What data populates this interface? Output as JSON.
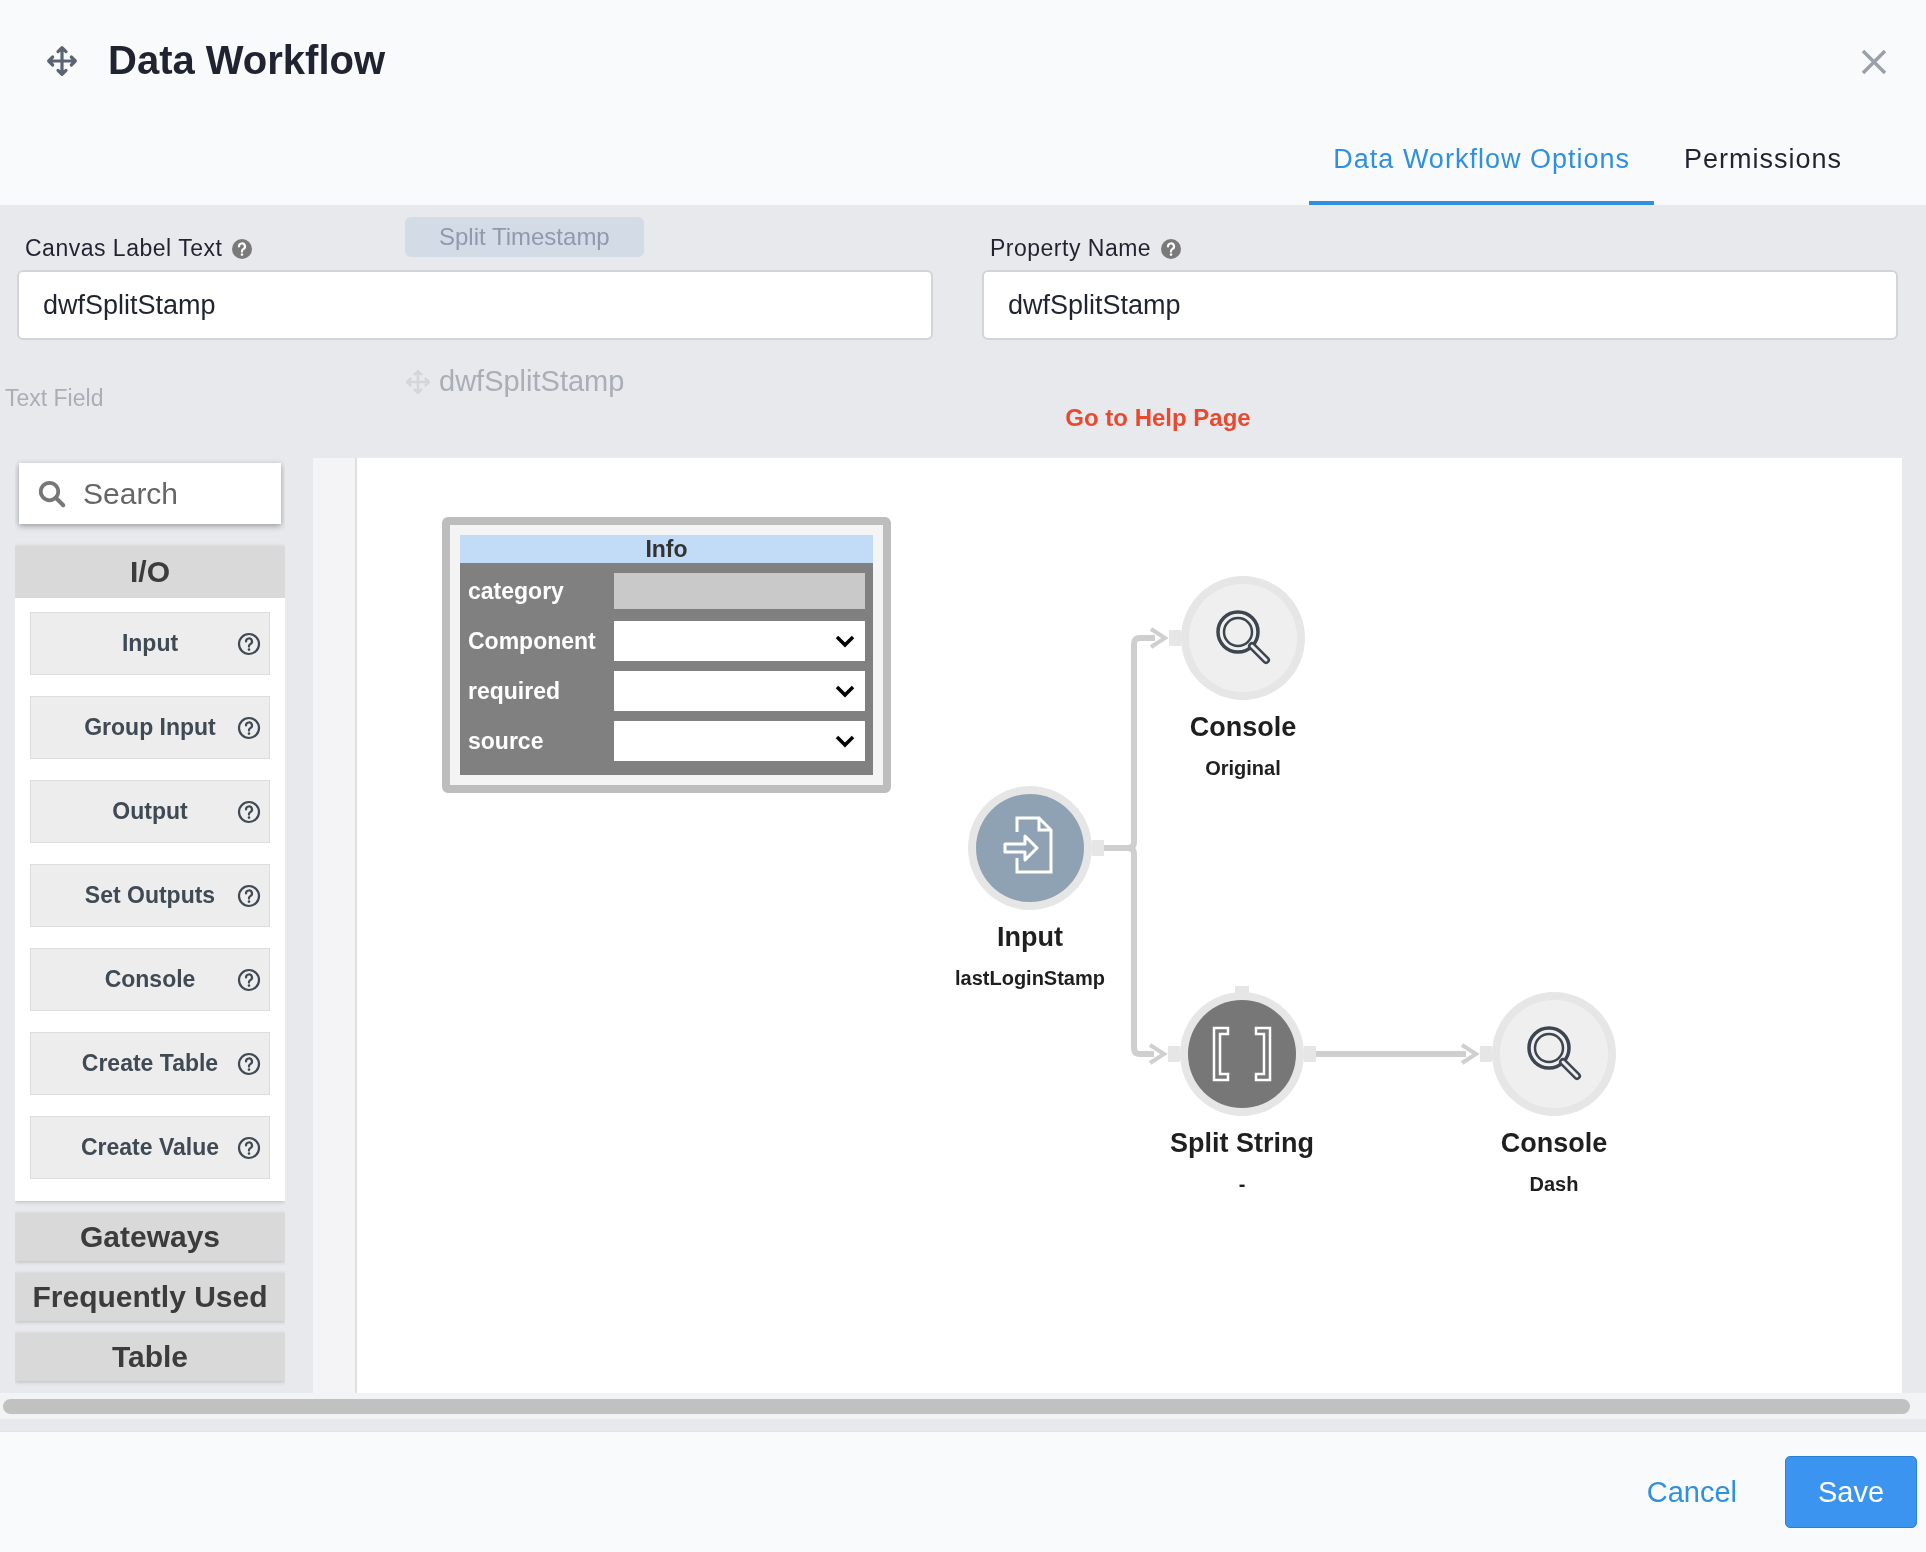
{
  "window": {
    "title": "Data Workflow"
  },
  "tabs": [
    {
      "label": "Data Workflow Options",
      "selected": true
    },
    {
      "label": "Permissions",
      "selected": false
    }
  ],
  "behind": [
    {
      "kind": "chip",
      "text": "Split Timestamp"
    },
    {
      "kind": "heading",
      "text": "dwfSplitStamp"
    },
    {
      "kind": "label",
      "text": "Text Field"
    }
  ],
  "fields": [
    {
      "label": "Canvas Label Text",
      "value": "dwfSplitStamp"
    },
    {
      "label": "Property Name",
      "value": "dwfSplitStamp"
    }
  ],
  "help_link": "Go to Help Page",
  "palette": {
    "search": {
      "placeholder": "Search"
    },
    "sections": [
      {
        "title": "I/O",
        "expanded": true,
        "items": [
          "Input",
          "Group Input",
          "Output",
          "Set Outputs",
          "Console",
          "Create Table",
          "Create Value"
        ]
      },
      {
        "title": "Gateways",
        "expanded": false
      },
      {
        "title": "Frequently Used",
        "expanded": false
      },
      {
        "title": "Table",
        "expanded": false
      }
    ]
  },
  "canvas": {
    "info_panel": {
      "title": "Info",
      "rows": [
        {
          "label": "category",
          "kind": "readonly"
        },
        {
          "label": "Component",
          "kind": "select"
        },
        {
          "label": "required",
          "kind": "select"
        },
        {
          "label": "source",
          "kind": "select"
        }
      ]
    },
    "nodes": [
      {
        "kind": "input",
        "title": "Input",
        "subtitle": "lastLoginStamp"
      },
      {
        "kind": "console",
        "title": "Console",
        "subtitle": "Original"
      },
      {
        "kind": "split",
        "title": "Split String",
        "subtitle": "-"
      },
      {
        "kind": "console",
        "title": "Console",
        "subtitle": "Dash"
      }
    ]
  },
  "buttons": {
    "cancel": "Cancel",
    "save": "Save"
  }
}
